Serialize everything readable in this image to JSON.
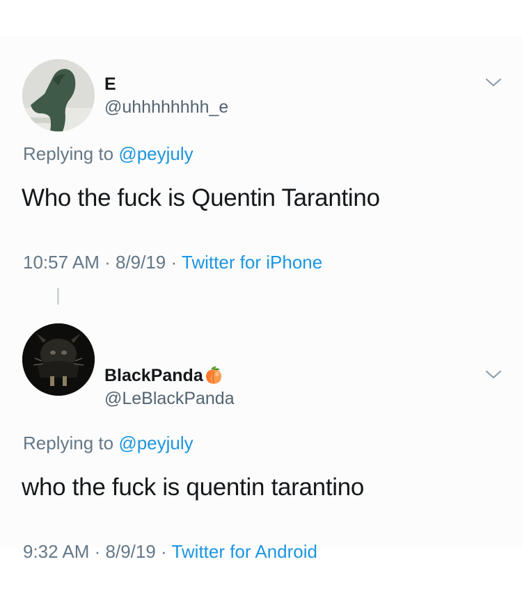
{
  "tweets": [
    {
      "display_name": "E",
      "handle": "@uhhhhhhhh_e",
      "replying_prefix": "Replying to",
      "replying_to": "@peyjuly",
      "text": "Who the fuck is Quentin Tarantino",
      "time": "10:57 AM",
      "date": "8/9/19",
      "source": "Twitter for iPhone",
      "separator": " · "
    },
    {
      "display_name": "BlackPanda",
      "name_emoji": "peach-emoji",
      "handle": "@LeBlackPanda",
      "replying_prefix": "Replying to",
      "replying_to": "@peyjuly",
      "text": "who the fuck is quentin tarantino",
      "time": "9:32 AM",
      "date": "8/9/19",
      "source": "Twitter for Android",
      "separator": " · "
    }
  ],
  "colors": {
    "link": "#1b95e0",
    "secondary_text": "#657786",
    "primary_text": "#14171a",
    "background": "#fcfcfc"
  }
}
